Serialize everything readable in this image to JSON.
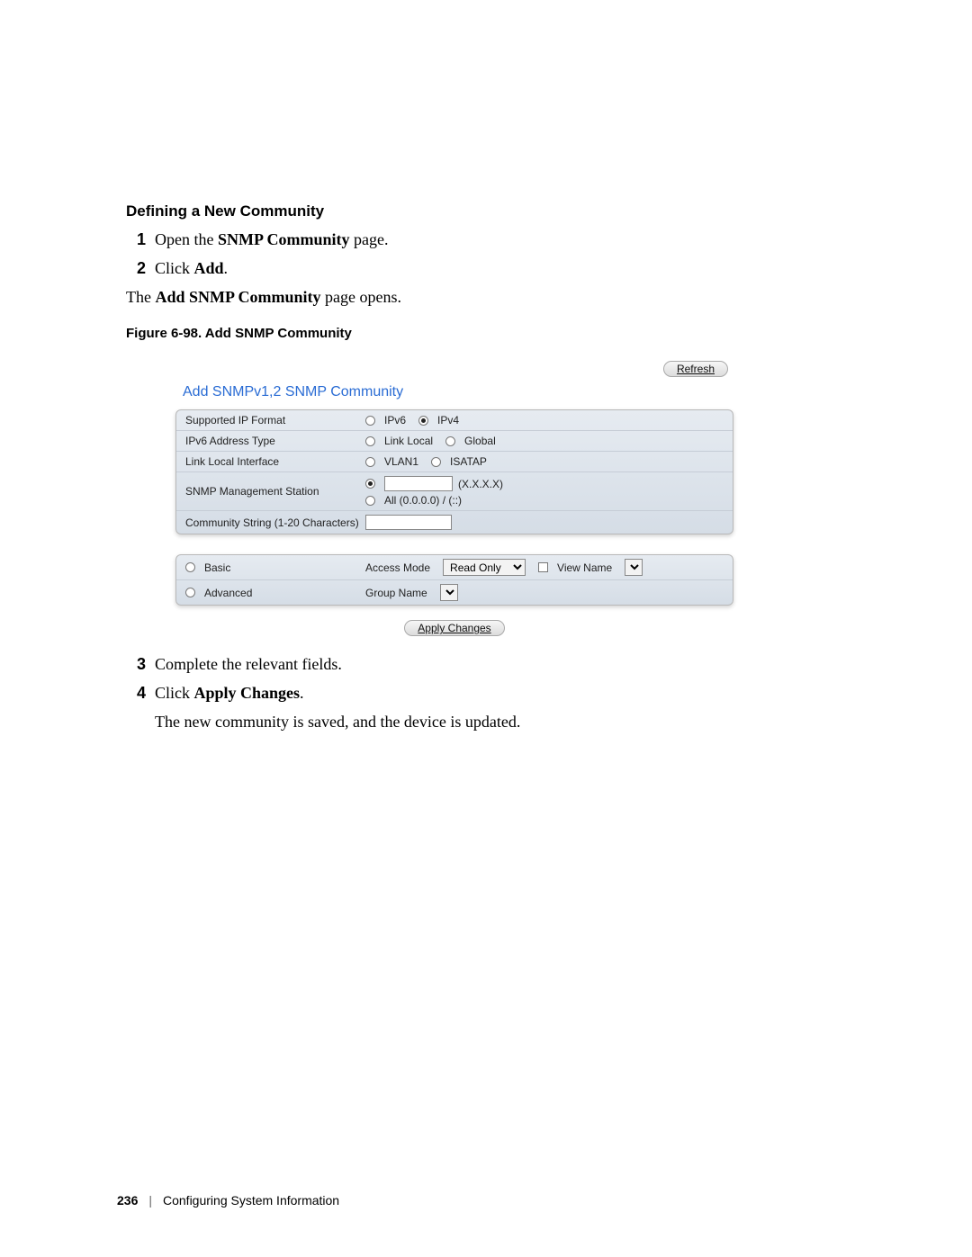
{
  "heading": "Defining a New Community",
  "steps_top": [
    {
      "n": "1",
      "pre": "Open the ",
      "bold": "SNMP Community",
      "post": " page."
    },
    {
      "n": "2",
      "pre": "Click ",
      "bold": "Add",
      "post": "."
    }
  ],
  "para1_pre": "The ",
  "para1_bold": "Add SNMP Community",
  "para1_post": " page opens.",
  "fig_caption": "Figure 6-98.    Add SNMP Community",
  "ss": {
    "refresh": "Refresh",
    "title": "Add SNMPv1,2 SNMP Community",
    "rows": {
      "ip_format": {
        "label": "Supported IP Format",
        "opt1": "IPv6",
        "opt2": "IPv4"
      },
      "addr_type": {
        "label": "IPv6 Address Type",
        "opt1": "Link Local",
        "opt2": "Global"
      },
      "ll_iface": {
        "label": "Link Local Interface",
        "opt1": "VLAN1",
        "opt2": "ISATAP"
      },
      "mgmt": {
        "label": "SNMP Management Station",
        "hint": "(X.X.X.X)",
        "all": "All  (0.0.0.0) / (::)"
      },
      "commstr": {
        "label": "Community String (1-20 Characters)"
      }
    },
    "panel2": {
      "basic": "Basic",
      "advanced": "Advanced",
      "access_mode_label": "Access Mode",
      "access_mode_value": "Read Only",
      "view_name": "View Name",
      "group_name": "Group Name"
    },
    "apply": "Apply Changes"
  },
  "steps_bottom": [
    {
      "n": "3",
      "pre": "Complete the relevant fields.",
      "bold": "",
      "post": ""
    },
    {
      "n": "4",
      "pre": "Click ",
      "bold": "Apply Changes",
      "post": "."
    }
  ],
  "result_line": "The new community is saved, and the device is updated.",
  "footer": {
    "page": "236",
    "section": "Configuring System Information"
  }
}
